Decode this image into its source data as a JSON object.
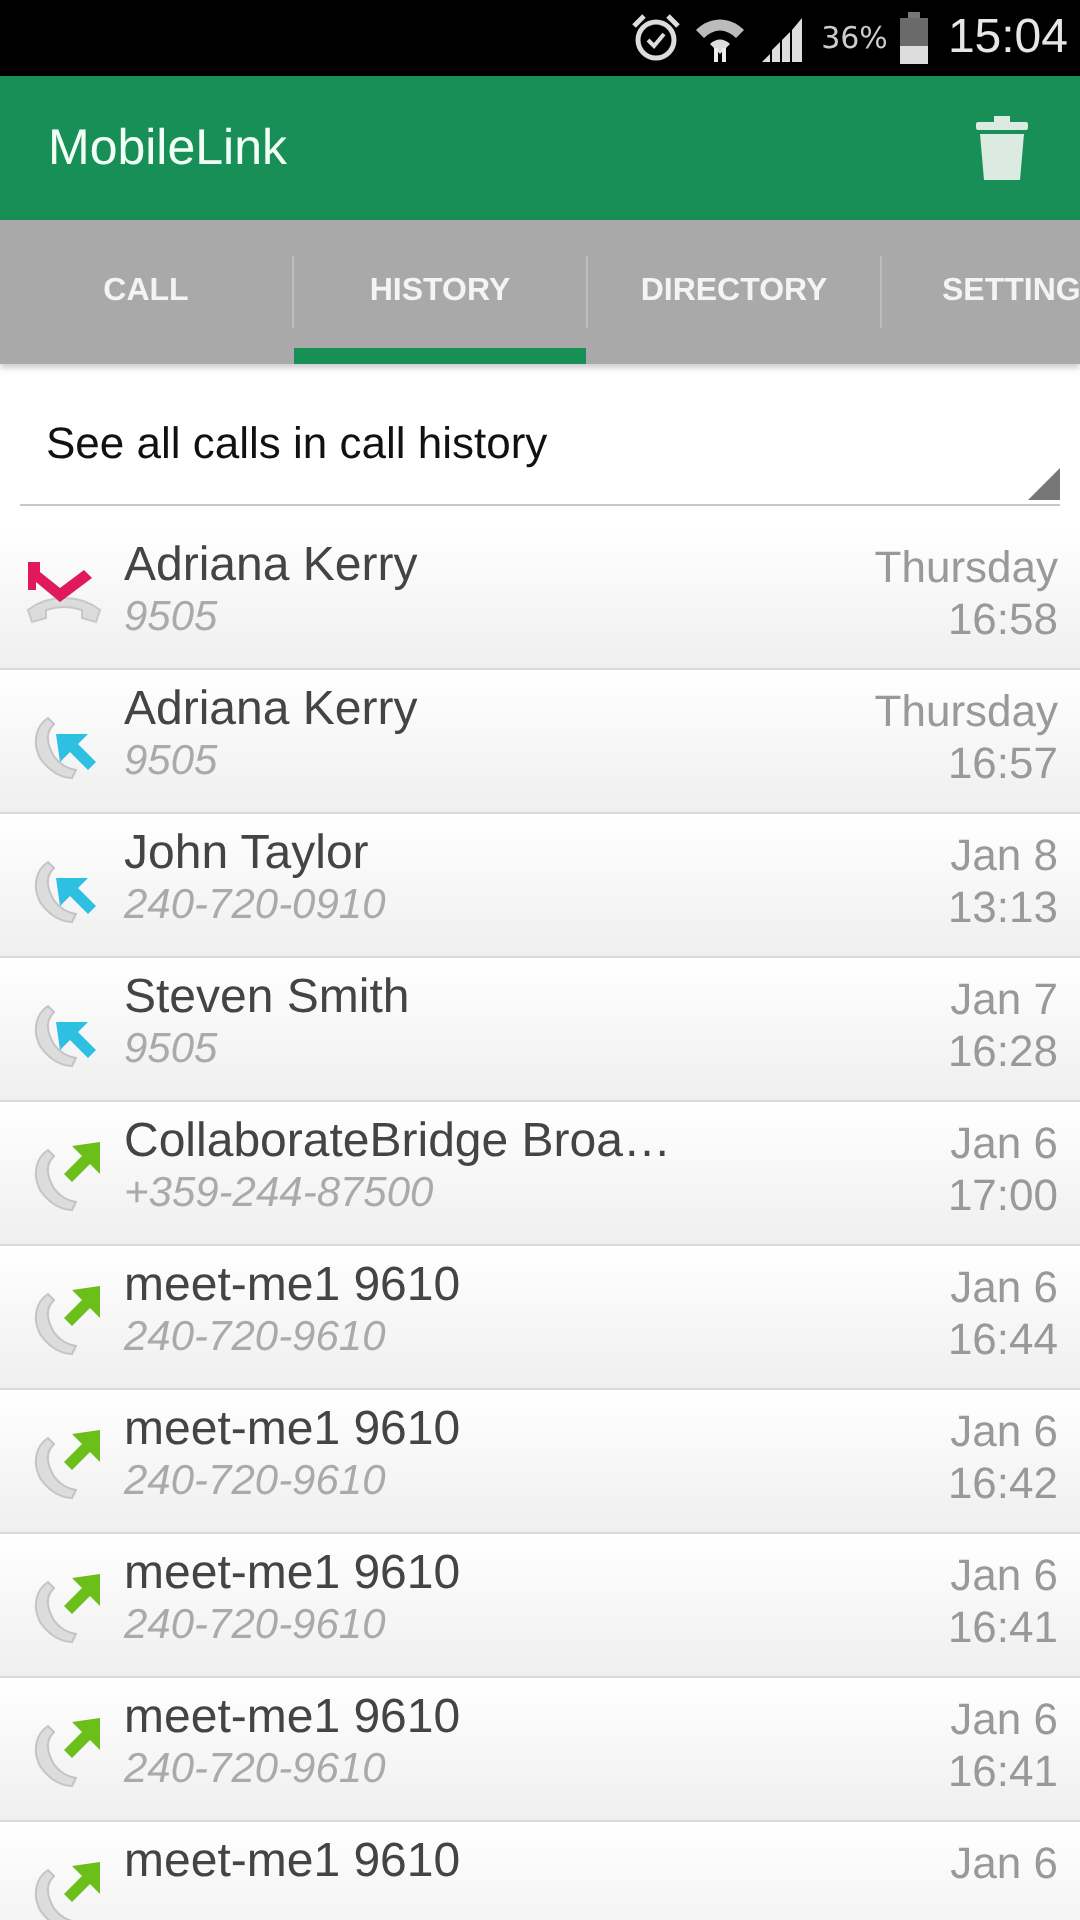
{
  "status_bar": {
    "battery_percent": "36%",
    "time": "15:04"
  },
  "app_bar": {
    "title": "MobileLink"
  },
  "tabs": [
    {
      "label": "CALL",
      "selected": false
    },
    {
      "label": "HISTORY",
      "selected": true
    },
    {
      "label": "DIRECTORY",
      "selected": false
    },
    {
      "label": "SETTING",
      "selected": false
    }
  ],
  "filter": {
    "value": "See all calls in call history"
  },
  "calls": [
    {
      "kind": "missed",
      "name": "Adriana Kerry",
      "number": "9505",
      "date": "Thursday",
      "time": "16:58"
    },
    {
      "kind": "incoming",
      "name": "Adriana Kerry",
      "number": "9505",
      "date": "Thursday",
      "time": "16:57"
    },
    {
      "kind": "incoming",
      "name": "John Taylor",
      "number": "240-720-0910",
      "date": "Jan 8",
      "time": "13:13"
    },
    {
      "kind": "incoming",
      "name": "Steven Smith",
      "number": "9505",
      "date": "Jan 7",
      "time": "16:28"
    },
    {
      "kind": "outgoing",
      "name": "CollaborateBridge Broa…",
      "number": "+359-244-87500",
      "date": "Jan 6",
      "time": "17:00"
    },
    {
      "kind": "outgoing",
      "name": "meet-me1 9610",
      "number": "240-720-9610",
      "date": "Jan 6",
      "time": "16:44"
    },
    {
      "kind": "outgoing",
      "name": "meet-me1 9610",
      "number": "240-720-9610",
      "date": "Jan 6",
      "time": "16:42"
    },
    {
      "kind": "outgoing",
      "name": "meet-me1 9610",
      "number": "240-720-9610",
      "date": "Jan 6",
      "time": "16:41"
    },
    {
      "kind": "outgoing",
      "name": "meet-me1 9610",
      "number": "240-720-9610",
      "date": "Jan 6",
      "time": "16:41"
    },
    {
      "kind": "outgoing",
      "name": "meet-me1 9610",
      "date": "Jan 6"
    }
  ]
}
